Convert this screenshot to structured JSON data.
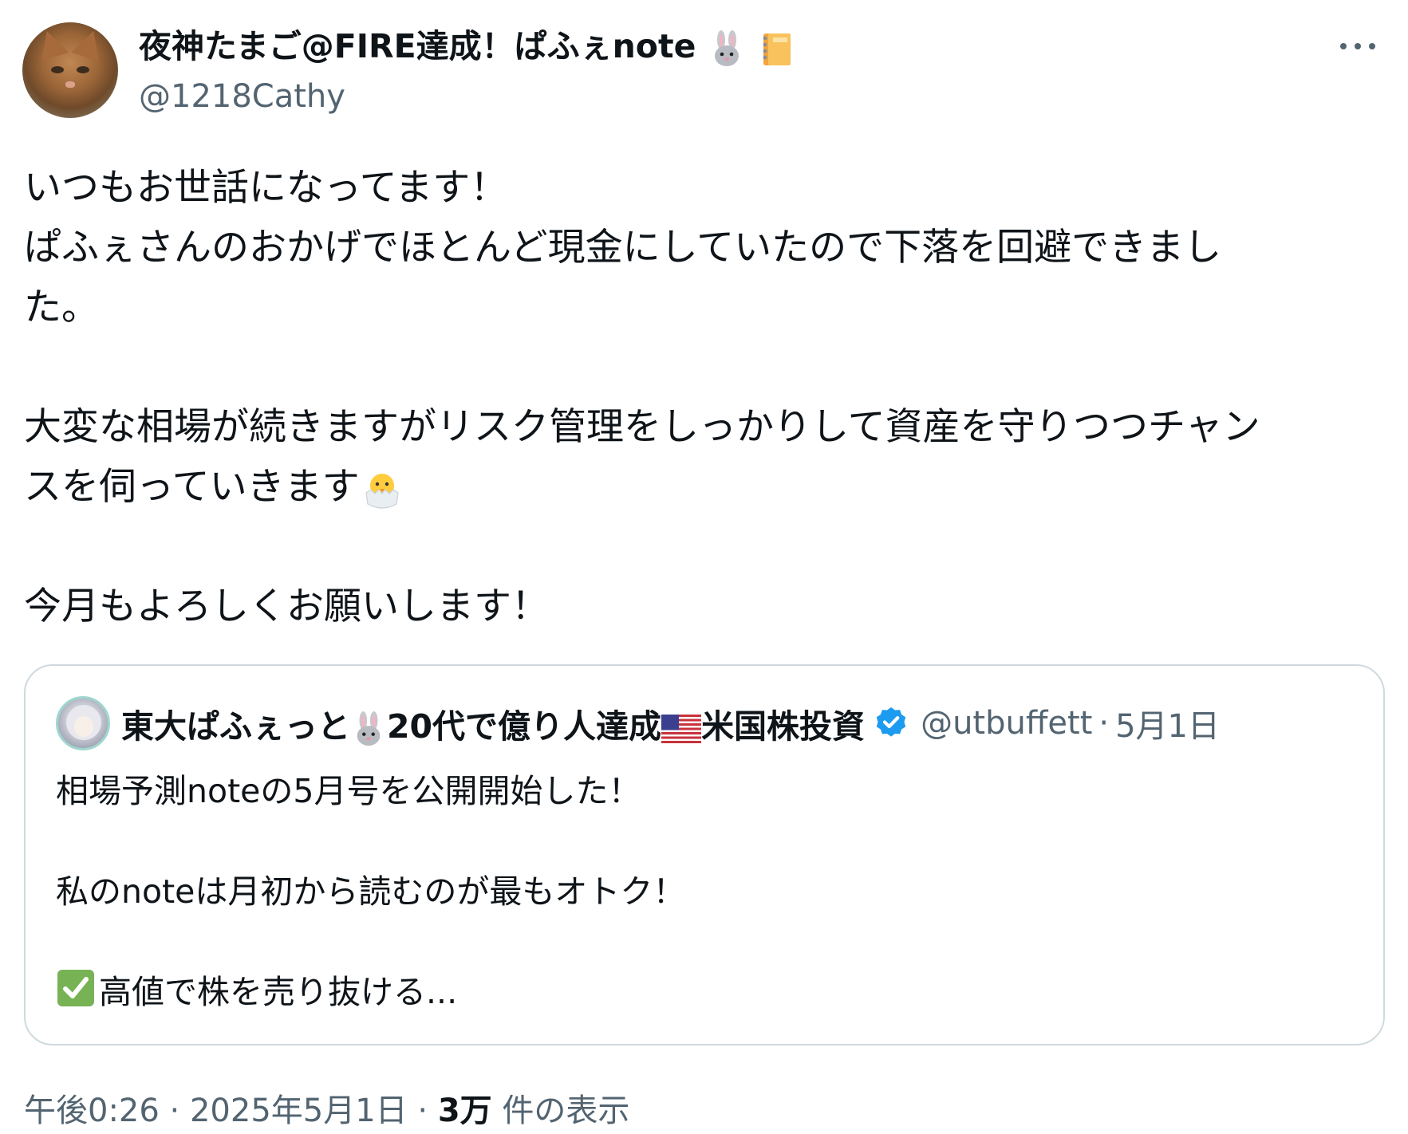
{
  "tweet": {
    "display_name": "夜神たまご@FIRE達成！ぱふぇnote",
    "name_emojis": [
      "rabbit-emoji",
      "notebook-emoji"
    ],
    "handle": "@1218Cathy",
    "body_lines": [
      "いつもお世話になってます！",
      "ぱふぇさんのおかげでほとんど現金にしていたので下落を回避できまし",
      "た。",
      "",
      "大変な相場が続きますがリスク管理をしっかりして資産を守りつつチャン",
      "スを伺っていきます",
      "",
      "今月もよろしくお願いします！"
    ],
    "body_emoji": "hatching-chick-emoji"
  },
  "quote": {
    "name_part1": "東大ぱふぇっと",
    "name_part2": "20代で億り人達成",
    "name_part3": "米国株投資",
    "handle": "@utbuffett",
    "separator": "·",
    "date": "5月1日",
    "lines": [
      "相場予測noteの5月号を公開開始した！",
      "",
      "私のnoteは月初から読むのが最もオトク！",
      "",
      "高値で株を売り抜ける..."
    ]
  },
  "footer": {
    "time": "午後0:26",
    "sep1": "·",
    "date": "2025年5月1日",
    "sep2": "·",
    "views_count": "3万",
    "views_label": "件の表示"
  },
  "colors": {
    "text": "#0f1419",
    "secondary": "#536471",
    "border": "#cfd9de",
    "verified": "#1d9bf0"
  }
}
